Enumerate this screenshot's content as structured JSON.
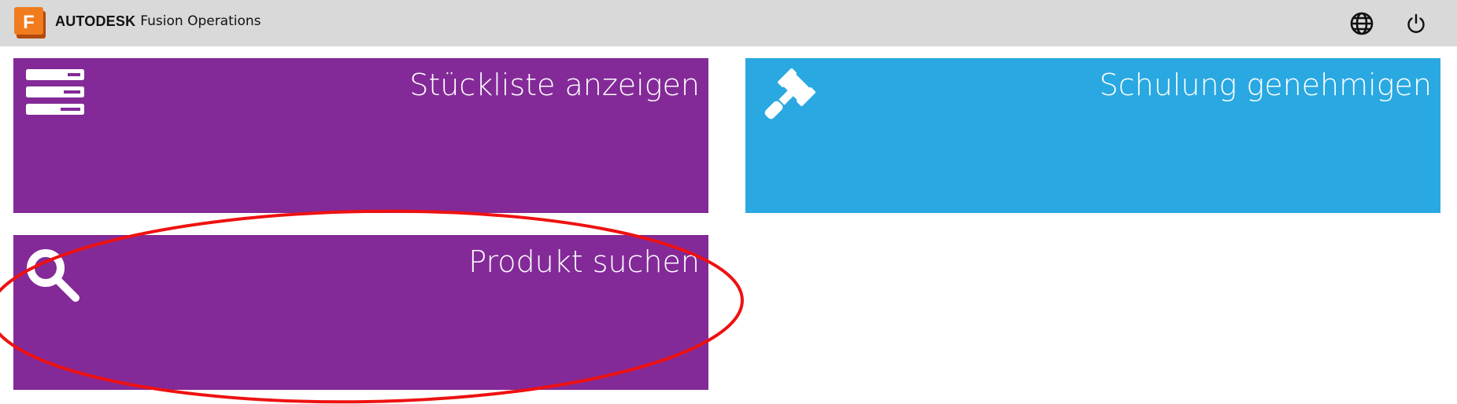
{
  "header": {
    "logo_letter": "F",
    "brand_bold": "AUTODESK",
    "brand_product": "Fusion Operations",
    "icons": [
      "globe-icon",
      "power-icon"
    ]
  },
  "tiles": [
    {
      "title": "Stückliste anzeigen",
      "icon": "list-icon",
      "color": "#832a98"
    },
    {
      "title": "Schulung genehmigen",
      "icon": "gavel-icon",
      "color": "#29a8e1"
    },
    {
      "title": "Produkt suchen",
      "icon": "search-icon",
      "color": "#832a98"
    }
  ],
  "colors": {
    "header_bg": "#d9d9d9",
    "logo_orange": "#f07c1e",
    "annotation_red": "#ee1111"
  }
}
